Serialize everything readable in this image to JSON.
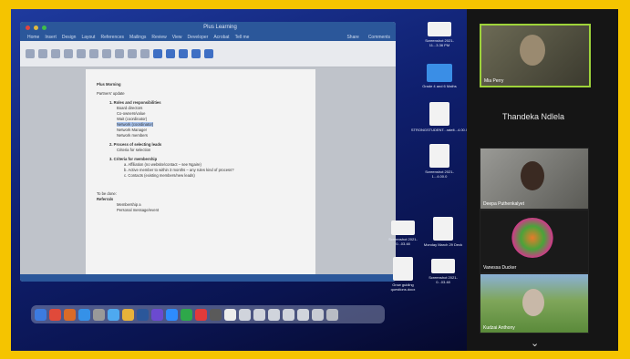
{
  "word": {
    "title": "Plus Learning",
    "tabs": [
      "Home",
      "Insert",
      "Design",
      "Layout",
      "References",
      "Mailings",
      "Review",
      "View",
      "Developer",
      "Acrobat",
      "Tell me"
    ],
    "share_label": "Share",
    "comments_label": "Comments",
    "doc": {
      "title": "Plus Morning",
      "subtitle": "Partners' update",
      "items": [
        {
          "level": 1,
          "text": "1. Roles and responsibilities",
          "bold": true
        },
        {
          "level": 2,
          "text": "Board directors"
        },
        {
          "level": 2,
          "text": "Co-owners/value"
        },
        {
          "level": 2,
          "text": "Wait (coordinator)"
        },
        {
          "level": 2,
          "text": "Network (coordinator)",
          "highlight": true
        },
        {
          "level": 2,
          "text": "Network Manager"
        },
        {
          "level": 2,
          "text": "Network members"
        },
        {
          "level": 1,
          "text": "2. Process of selecting leads",
          "bold": true
        },
        {
          "level": 2,
          "text": "Criteria for selection"
        },
        {
          "level": 1,
          "text": "3. Criteria for membership",
          "bold": true
        },
        {
          "level": 3,
          "text": "a. Affiliation (no website/contact – see Ngaire)"
        },
        {
          "level": 3,
          "text": "b. Active member to within 3 months – any rules kind of process?"
        },
        {
          "level": 3,
          "text": "c. Contacts (existing members/new leads)"
        }
      ],
      "footer_heading": "To be done:",
      "footer_sub": "Referrals",
      "footer_items": [
        "Membership a",
        "Personal message/event"
      ]
    }
  },
  "desktop_icons": [
    {
      "label": "Screenshot 2021-11...3.36 PM"
    },
    {
      "label": "Grade 4 and 6 Maths"
    },
    {
      "label": "STRONGSTUDENT...ratelt...4.00.0"
    },
    {
      "label": "Screenshot 2021-1...4.00.0"
    },
    {
      "label": "Screenshot 2021-0...03.48"
    },
    {
      "label": "Monday March 29 Deck"
    },
    {
      "label": "Grow guiding questions.docx"
    },
    {
      "label": "Screenshot 2021-0...03.48"
    }
  ],
  "participants": [
    {
      "name": "Mia Perry",
      "active": true
    },
    {
      "name": "Thandeka Ndlela",
      "camera_off": true
    },
    {
      "name": "Deepa Puthenkalyet",
      "active": false
    },
    {
      "name": "Vanessa Ducker",
      "active": false
    },
    {
      "name": "Kudzai Anthony",
      "active": false
    }
  ],
  "colors": {
    "border": "#f5c400",
    "word_blue": "#2b579a",
    "active_speaker": "#9ed33a"
  }
}
